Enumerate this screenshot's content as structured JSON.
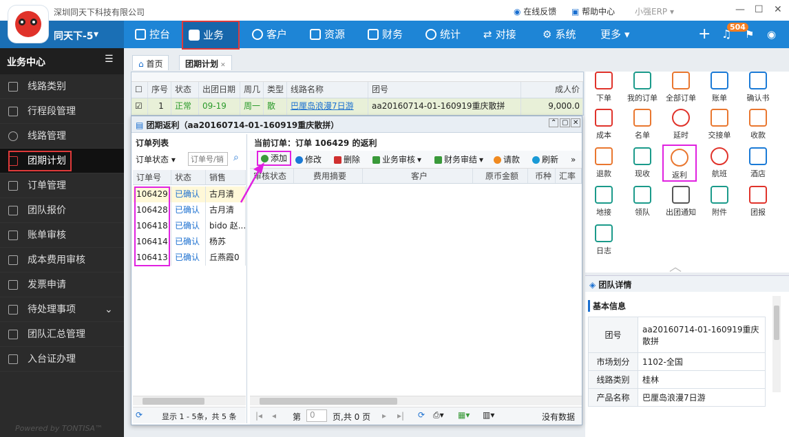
{
  "app": {
    "company": "深圳同天下科技有限公司",
    "org": "同天下-5",
    "feedback": "在线反馈",
    "help": "帮助中心",
    "erp": "小强ERP",
    "badge": "504",
    "powered": "Powered by TONTISA™"
  },
  "nav": {
    "items": [
      "控台",
      "业务",
      "客户",
      "资源",
      "财务",
      "统计",
      "对接",
      "系统",
      "更多"
    ]
  },
  "sidebar": {
    "title": "业务中心",
    "items": [
      "线路类别",
      "行程段管理",
      "线路管理",
      "团期计划",
      "订单管理",
      "团队报价",
      "账单审核",
      "成本费用审核",
      "发票申请",
      "待处理事项",
      "团队汇总管理",
      "入台证办理"
    ]
  },
  "tabs": {
    "home": "首页",
    "plan": "团期计划"
  },
  "plangrid": {
    "cols": [
      "序号",
      "状态",
      "出团日期",
      "周几",
      "类型",
      "线路名称",
      "团号",
      "成人价"
    ],
    "row": [
      "1",
      "正常",
      "09-19",
      "周一",
      "散",
      "巴厘岛浪漫7日游",
      "aa20160714-01-160919重庆散拼",
      "9,000.0"
    ]
  },
  "dialog": {
    "title": "团期返利（aa20160714-01-160919重庆散拼）",
    "orders_title": "订单列表",
    "status_filter": "订单状态",
    "search_placeholder": "订单号/销",
    "order_cols": [
      "订单号",
      "状态",
      "销售"
    ],
    "orders": [
      [
        "106429",
        "已确认",
        "古月清"
      ],
      [
        "106428",
        "已确认",
        "古月清"
      ],
      [
        "106418",
        "已确认",
        "bido 赵..."
      ],
      [
        "106414",
        "已确认",
        "杨苏"
      ],
      [
        "106413",
        "已确认",
        "丘燕霞0"
      ]
    ],
    "summary": "显示 1 - 5条，共 5 条",
    "current": "当前订单：订单 106429 的返利",
    "tools": [
      "添加",
      "修改",
      "删除",
      "业务审核",
      "财务审结",
      "请款",
      "刷新"
    ],
    "right_cols": [
      "审核状态",
      "费用摘要",
      "客户",
      "原币金额",
      "币种",
      "汇率"
    ],
    "pager_page": "第",
    "pager_page_value": "0",
    "pager_total": "页,共 0 页",
    "nodata": "没有数据"
  },
  "icons": [
    "下单",
    "我的订单",
    "全部订单",
    "账单",
    "确认书",
    "成本",
    "名单",
    "延时",
    "交接单",
    "收款",
    "退款",
    "现收",
    "返利",
    "航班",
    "酒店",
    "地接",
    "领队",
    "出团通知",
    "附件",
    "团报",
    "日志"
  ],
  "detail": {
    "title": "团队详情",
    "section": "基本信息",
    "rows": [
      [
        "团号",
        "aa20160714-01-160919重庆散拼"
      ],
      [
        "市场划分",
        "1102-全国"
      ],
      [
        "线路类别",
        "桂林"
      ],
      [
        "产品名称",
        "巴厘岛浪漫7日游"
      ]
    ]
  }
}
